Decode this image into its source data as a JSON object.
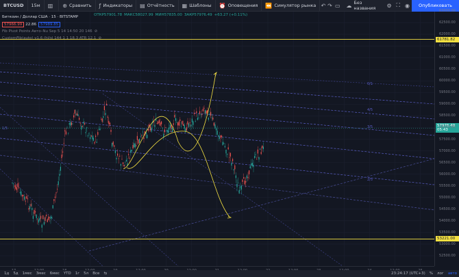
{
  "toolbar": {
    "symbol": "BTCUSD",
    "interval": "15м",
    "compare": "Сравнить",
    "indicators": "Индикаторы",
    "financials": "Отчётность",
    "templates": "Шаблоны",
    "alerts": "Оповещения",
    "market_sim": "Симулятор рынка",
    "layout_name": "Без названия",
    "publish": "Опубликовать"
  },
  "legend": {
    "title": "Биткоин / Доллар США · 15 · BITSTAMP",
    "open": "ОТКР57901.78",
    "high": "МАКС58027.99",
    "low": "МИН57835.00",
    "close": "ЗАКР57976.49",
    "change": "+63.27 (+0.11%)",
    "bid": "57966.99",
    "spread": "22.86",
    "ask": "57989.85",
    "indicator1": "Fib Pivot Points Авто–Nu Sep 5 14 14:50 20 146",
    "indicator2": "CustomFib(auto) v1.6 (hl/sl 144 1 1 18.3 ATR 12.1"
  },
  "price_axis": {
    "ticks": [
      "63000.00",
      "62500.00",
      "62000.00",
      "61500.00",
      "61000.00",
      "60500.00",
      "60000.00",
      "59500.00",
      "59000.00",
      "58500.00",
      "58000.00",
      "57500.00",
      "57000.00",
      "56500.00",
      "56000.00",
      "55500.00",
      "55000.00",
      "54500.00",
      "54000.00",
      "53500.00",
      "53000.00",
      "52500.00"
    ],
    "upper_level": "61781.82",
    "current_price": "57976.49",
    "countdown": "05:43",
    "lower_level": "53221.00"
  },
  "fib_labels": [
    "0/1",
    "4/5",
    "3/5",
    "2/5",
    "1/5"
  ],
  "time_axis": [
    "17",
    "12:00",
    "18",
    "12:00",
    "19",
    "12:00",
    "20",
    "12:00",
    "21",
    "12:00",
    "22",
    "12:00",
    "23",
    "12:00",
    "24",
    "12:00",
    "25"
  ],
  "bottom": {
    "ranges": [
      "1д",
      "5д",
      "1мес",
      "3мес",
      "6мес",
      "YTD",
      "1г",
      "5л",
      "Все"
    ],
    "clock": "23:24:17 (UTC+3)",
    "pct": "%",
    "log": "лог",
    "auto": "авто"
  },
  "colors": {
    "up": "#26a69a",
    "down": "#ef5350",
    "level": "#f5e142",
    "fib": "#5a5fc8",
    "accent": "#2962ff"
  },
  "icons": {
    "compare": "plus-circle-icon",
    "indicators": "fx-icon",
    "alerts": "alarm-clock-icon",
    "replay": "rewind-icon"
  }
}
